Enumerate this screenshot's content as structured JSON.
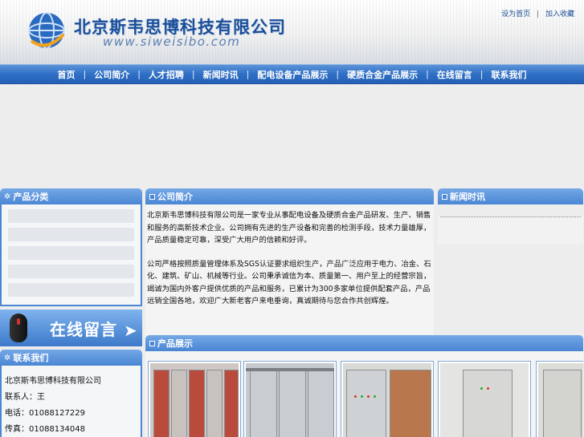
{
  "header": {
    "company_name": "北京斯韦思博科技有限公司",
    "company_url": "www.siweisibo.com",
    "links": [
      "设为首页",
      "加入收藏"
    ]
  },
  "nav": {
    "items": [
      "首页",
      "公司简介",
      "人才招聘",
      "新闻时讯",
      "配电设备产品展示",
      "硬质合金产品展示",
      "在线留言",
      "联系我们"
    ],
    "separator": "|"
  },
  "sidebar": {
    "category_title": "产品分类",
    "message_banner": "在线留言",
    "contact_title": "联系我们",
    "contact_lines": [
      "北京斯韦思博科技有限公司",
      "联系人：王",
      "电话：01088127229",
      "传真：01088134048"
    ]
  },
  "about": {
    "title": "公司简介",
    "paragraph1": "北京斯韦思博科技有限公司是一家专业从事配电设备及硬质合金产品研发、生产、销售和服务的高新技术企业。公司拥有先进的生产设备和完善的检测手段，技术力量雄厚，产品质量稳定可靠，深受广大用户的信赖和好评。",
    "paragraph2": "公司严格按照质量管理体系及SGS认证要求组织生产，产品广泛应用于电力、冶金、石化、建筑、矿山、机械等行业。公司秉承诚信为本、质量第一、用户至上的经营宗旨，竭诚为国内外客户提供优质的产品和服务，已累计为300多家单位提供配套产品，产品远销全国各地，欢迎广大新老客户来电垂询，真诚期待与您合作共创辉煌。"
  },
  "news": {
    "title": "新闻时讯"
  },
  "products": {
    "title": "产品展示"
  },
  "colors": {
    "accent": "#4a86d4",
    "brand": "#1b4f9a"
  }
}
